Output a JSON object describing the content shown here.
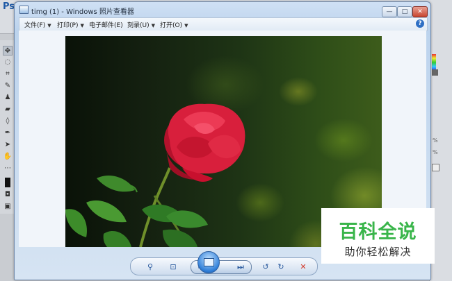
{
  "photoshop": {
    "logo": "Ps",
    "panel_percent_1": "%",
    "panel_percent_2": "%"
  },
  "viewer": {
    "title": "timg (1) - Windows 照片查看器",
    "minimize_label": "—",
    "maximize_label": "□",
    "close_label": "✕",
    "menu": [
      {
        "label": "文件(F)"
      },
      {
        "label": "打印(P)"
      },
      {
        "label": "电子邮件(E)"
      },
      {
        "label": "刻录(U)"
      },
      {
        "label": "打开(O)"
      }
    ],
    "help_label": "?",
    "controls": {
      "zoom": "⚲",
      "actual_size": "⊡",
      "prev": "⏮",
      "next": "⏭",
      "rotate_ccw": "↺",
      "rotate_cw": "↻",
      "delete": "✕"
    }
  },
  "watermark": {
    "title": "百科全说",
    "subtitle": "助你轻松解决"
  },
  "colors": {
    "watermark_green": "#39b54a",
    "rose_red": "#d81f3c",
    "delete_red": "#d23a2a"
  }
}
